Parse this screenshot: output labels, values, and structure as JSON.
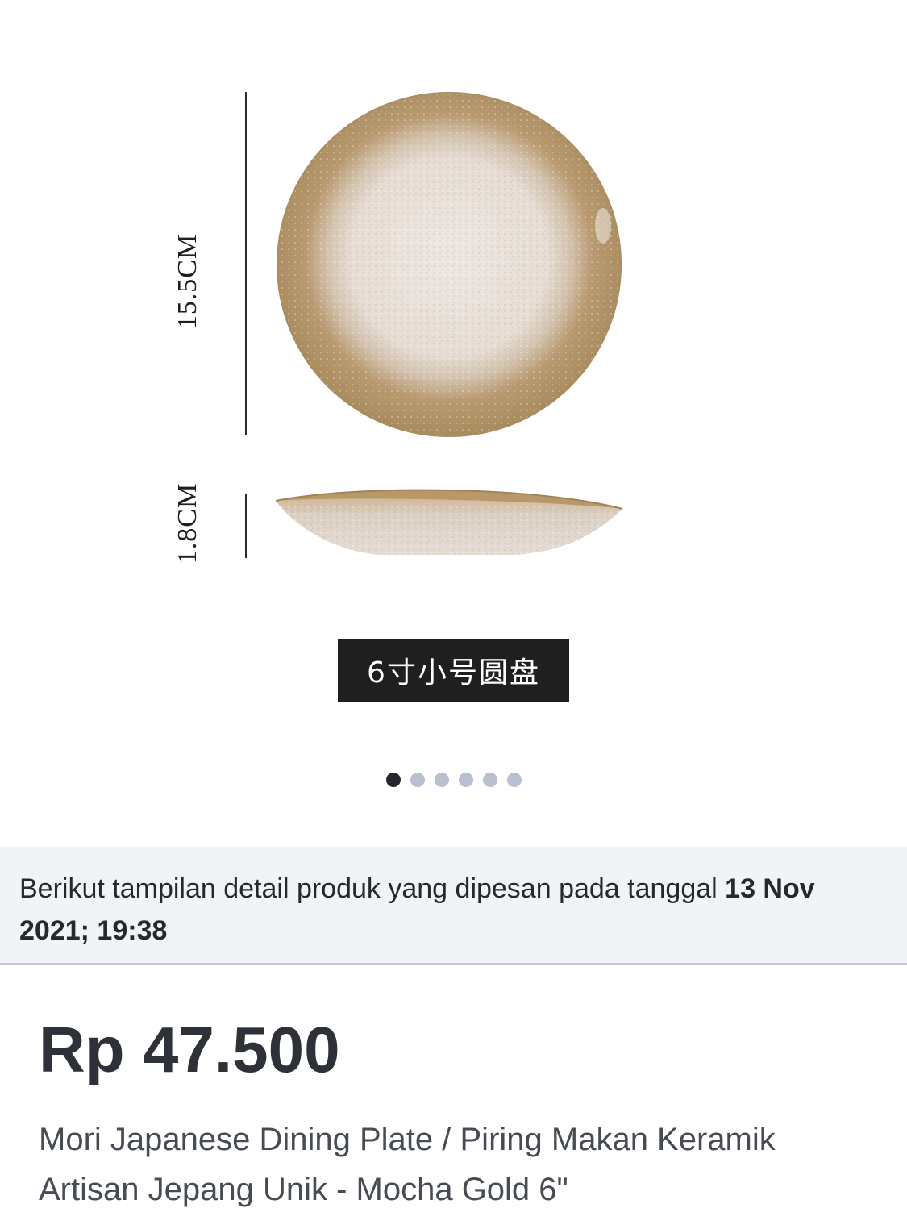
{
  "gallery": {
    "image": {
      "diameter_label": "15.5CM",
      "height_label": "1.8CM",
      "variant_label": "6寸小号圆盘"
    },
    "dots": {
      "count": 6,
      "active_index": 0
    }
  },
  "order_info": {
    "prefix": "Berikut tampilan detail produk yang dipesan pada tanggal ",
    "date": "13 Nov 2021; 19:38"
  },
  "product": {
    "price": "Rp 47.500",
    "name": "Mori Japanese Dining Plate / Piring Makan Keramik Artisan Jepang Unik - Mocha Gold 6\""
  }
}
